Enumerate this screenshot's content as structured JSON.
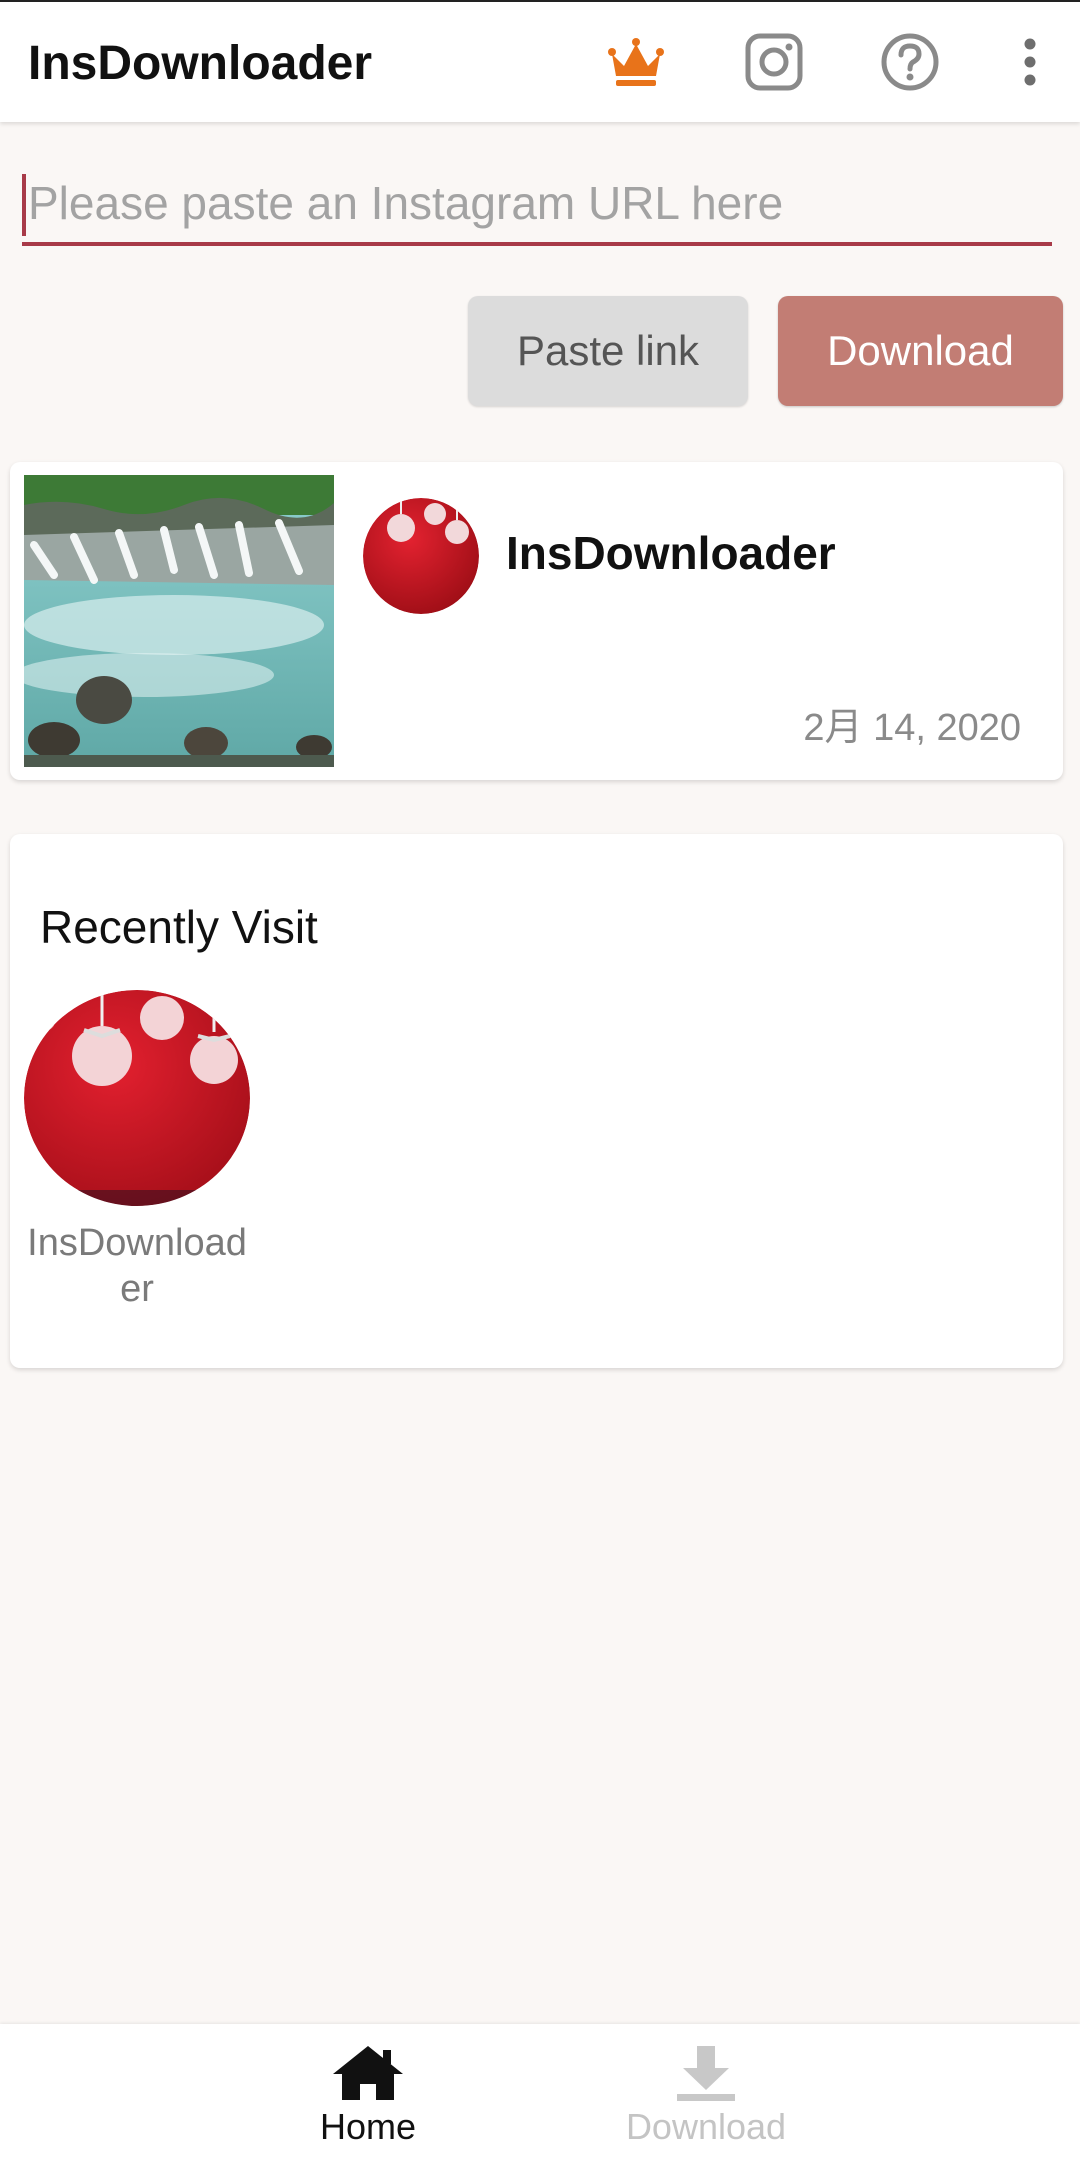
{
  "appbar": {
    "title": "InsDownloader",
    "icons": [
      "crown-icon",
      "instagram-icon",
      "help-icon",
      "more-vert-icon"
    ]
  },
  "input": {
    "placeholder": "Please paste an Instagram URL here",
    "value": ""
  },
  "buttons": {
    "paste_label": "Paste link",
    "download_label": "Download"
  },
  "post": {
    "username": "InsDownloader",
    "date": "2月 14, 2020"
  },
  "recent": {
    "title": "Recently Visit",
    "items": [
      {
        "name": "InsDownloader"
      }
    ]
  },
  "nav": {
    "home_label": "Home",
    "download_label": "Download"
  },
  "colors": {
    "accent": "#a83a48",
    "download_button": "#c27d74",
    "crown": "#e8731a"
  }
}
